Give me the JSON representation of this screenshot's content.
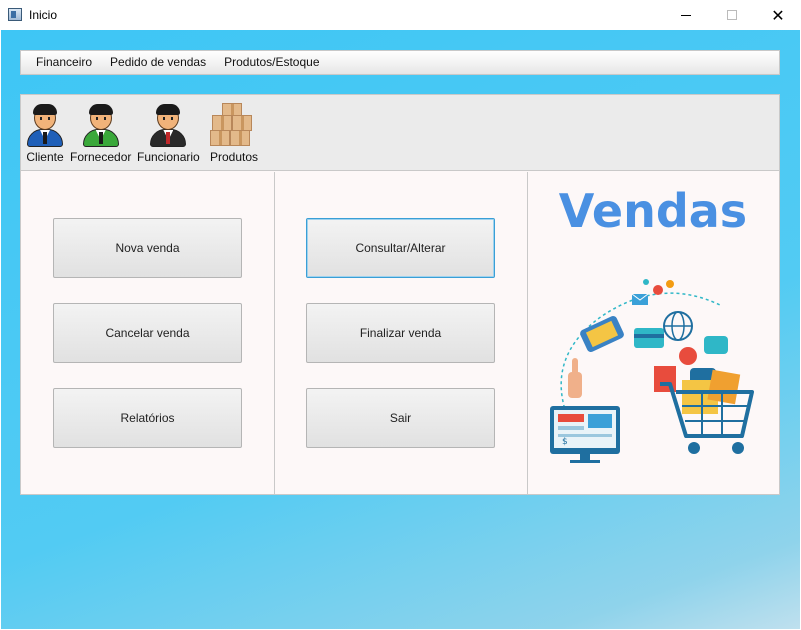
{
  "window": {
    "title": "Inicio"
  },
  "menu": [
    "Financeiro",
    "Pedido de vendas",
    "Produtos/Estoque"
  ],
  "toolbar": {
    "cliente": "Cliente",
    "fornecedor": "Fornecedor",
    "funcionario": "Funcionario",
    "produtos": "Produtos"
  },
  "buttons": {
    "nova_venda": "Nova venda",
    "cancelar_venda": "Cancelar venda",
    "relatorios": "Relatórios",
    "consultar": "Consultar/Alterar",
    "finalizar": "Finalizar venda",
    "sair": "Sair"
  },
  "banner": {
    "title": "Vendas"
  },
  "colors": {
    "accent": "#4a90e2",
    "background": "#3ec6f5",
    "panel": "#fdf8f8"
  },
  "icons": [
    "cliente-icon",
    "fornecedor-icon",
    "funcionario-icon",
    "produtos-icon",
    "shopping-illustration"
  ]
}
